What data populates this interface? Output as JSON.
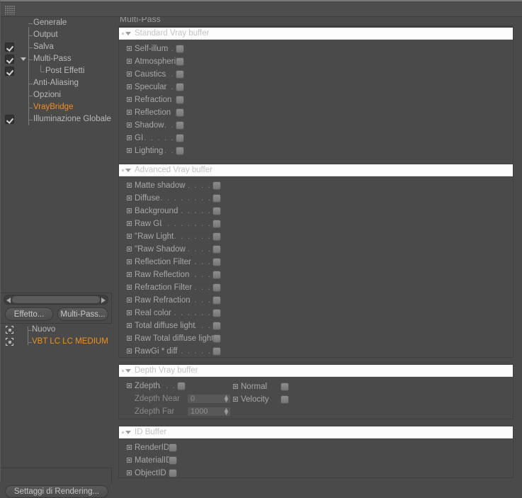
{
  "window": {
    "title": "Multi-Pass",
    "grip_icon": "drag-grip-icon"
  },
  "sidebar": {
    "tree": [
      {
        "label": "Generale",
        "checkbox": false,
        "indent": 0,
        "selected": false,
        "arrow": false
      },
      {
        "label": "Output",
        "checkbox": false,
        "indent": 0,
        "selected": false,
        "arrow": false
      },
      {
        "label": "Salva",
        "checkbox": true,
        "indent": 0,
        "selected": false,
        "arrow": false
      },
      {
        "label": "Multi-Pass",
        "checkbox": true,
        "indent": 0,
        "selected": false,
        "arrow": true
      },
      {
        "label": "Post Effetti",
        "checkbox": true,
        "indent": 1,
        "selected": false,
        "arrow": false
      },
      {
        "label": "Anti-Aliasing",
        "checkbox": false,
        "indent": 0,
        "selected": false,
        "arrow": false
      },
      {
        "label": "Opzioni",
        "checkbox": false,
        "indent": 0,
        "selected": false,
        "arrow": false
      },
      {
        "label": "VrayBridge",
        "checkbox": false,
        "indent": 0,
        "selected": true,
        "arrow": false
      },
      {
        "label": "Illuminazione Globale",
        "checkbox": true,
        "indent": 0,
        "selected": false,
        "arrow": false
      }
    ],
    "scrollbar": {
      "name": "horizontal-scrollbar"
    },
    "buttons": {
      "effetto": "Effetto...",
      "multipass": "Multi-Pass..."
    },
    "materials": [
      {
        "label": "Nuovo",
        "selected": false,
        "icon": "multipass-layer-icon"
      },
      {
        "label": "VBT LC LC MEDIUM",
        "selected": true,
        "icon": "multipass-layer-icon"
      }
    ],
    "render_button": "Settaggi di Rendering...",
    "accent_color": "#f0911e"
  },
  "main": {
    "title": "Multi-Pass",
    "groups": [
      {
        "title": "Standard Vray buffer",
        "expanded": true,
        "rows": [
          {
            "label": "Self-illum",
            "dots": ". . .",
            "checked": false
          },
          {
            "label": "Atmospheric",
            "dots": "",
            "checked": false
          },
          {
            "label": "Caustics",
            "dots": ". . .",
            "checked": false
          },
          {
            "label": "Specular",
            "dots": ". . .",
            "checked": false
          },
          {
            "label": "Refraction",
            "dots": "",
            "checked": false
          },
          {
            "label": "Reflection",
            "dots": "",
            "checked": false
          },
          {
            "label": "Shadow",
            "dots": ". . .",
            "checked": false
          },
          {
            "label": "GI",
            "dots": ". . . . . . . .",
            "checked": false
          },
          {
            "label": "Lighting",
            "dots": ". . .",
            "checked": false
          }
        ]
      },
      {
        "title": "Advanced Vray buffer",
        "expanded": true,
        "rows": [
          {
            "label": "Matte shadow",
            "dots": ". . . . . .",
            "checked": false
          },
          {
            "label": "Diffuse",
            "dots": ". . . . . . . . .",
            "checked": false
          },
          {
            "label": "Background",
            "dots": ". . . . . . . .",
            "checked": false
          },
          {
            "label": "Raw GI",
            "dots": ". . . . . . . . .",
            "checked": false
          },
          {
            "label": "\"Raw Light",
            "dots": ". . . . . . . .",
            "checked": false
          },
          {
            "label": "\"Raw Shadow",
            "dots": ". . . . . .",
            "checked": false
          },
          {
            "label": "Reflection Filter",
            "dots": ". . . . .",
            "checked": false
          },
          {
            "label": "Raw Reflection",
            "dots": ". . . . .",
            "checked": false
          },
          {
            "label": "Refraction Filter",
            "dots": ". . . . .",
            "checked": false
          },
          {
            "label": "Raw Refraction",
            "dots": ". . . . .",
            "checked": false
          },
          {
            "label": "Real color",
            "dots": ". . . . . . . .",
            "checked": false
          },
          {
            "label": "Total diffuse light",
            "dots": ". . . .",
            "checked": false
          },
          {
            "label": "Raw Total diffuse light",
            "dots": "",
            "checked": false
          },
          {
            "label": "RawGi * diff",
            "dots": ". . . . . . .",
            "checked": false
          }
        ]
      },
      {
        "title": "Depth Vray buffer",
        "expanded": true,
        "rows": [
          {
            "label": "Zdepth",
            "dots": ". . . .",
            "checked": false
          }
        ],
        "fields": [
          {
            "label": "Zdepth Near",
            "value": "0",
            "disabled": true
          },
          {
            "label": "Zdepth Far",
            "value": "1000",
            "disabled": true
          }
        ],
        "right_rows": [
          {
            "label": "Normal",
            "checked": false
          },
          {
            "label": "Velocity",
            "checked": false
          }
        ]
      },
      {
        "title": "ID Buffer",
        "expanded": true,
        "rows": [
          {
            "label": "RenderID",
            "dots": "",
            "checked": false
          },
          {
            "label": "MaterialID",
            "dots": "",
            "checked": false
          },
          {
            "label": "ObjectID",
            "dots": "",
            "checked": false
          }
        ]
      }
    ]
  }
}
